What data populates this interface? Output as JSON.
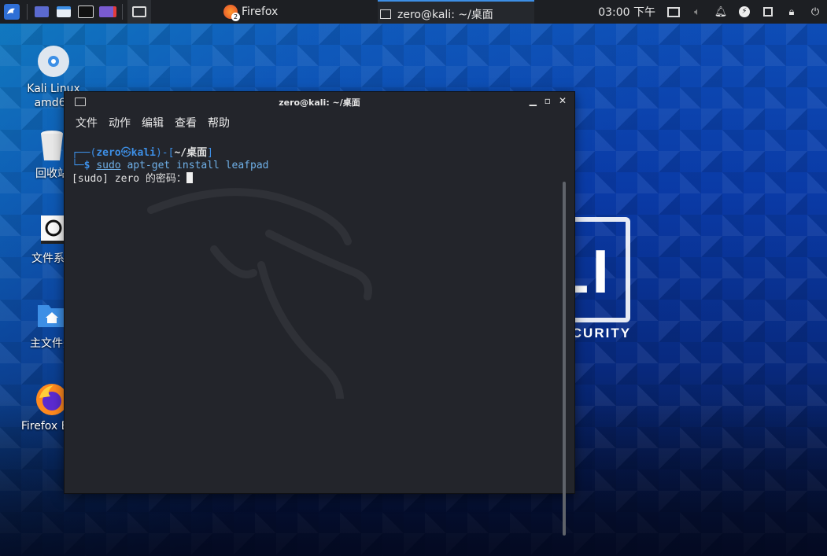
{
  "taskbar": {
    "firefox_task": "Firefox",
    "firefox_badge": "2",
    "terminal_task": "zero@kali: ~/桌面",
    "clock": "03:00 下午"
  },
  "desktop": {
    "icons": [
      {
        "label": "Kali Linux amd64"
      },
      {
        "label": "回收站"
      },
      {
        "label": "文件系统"
      },
      {
        "label": "主文件夹"
      },
      {
        "label": "Firefox ESR"
      }
    ],
    "wallpaper_text": {
      "logo": "KALI",
      "sub": "BY OFFENSIVE SECURITY"
    }
  },
  "terminal": {
    "title": "zero@kali: ~/桌面",
    "menu": [
      "文件",
      "动作",
      "编辑",
      "查看",
      "帮助"
    ],
    "prompt_user": "zero",
    "prompt_at": "㉿",
    "prompt_host": "kali",
    "prompt_dir": "~/桌面",
    "command_sudo": "sudo",
    "command_rest": "apt-get install leafpad",
    "output_line": "[sudo] zero 的密码："
  },
  "colors": {
    "accent": "#3d8fe6",
    "terminal_bg": "#23252b",
    "taskbar_bg": "#1d1f23"
  }
}
